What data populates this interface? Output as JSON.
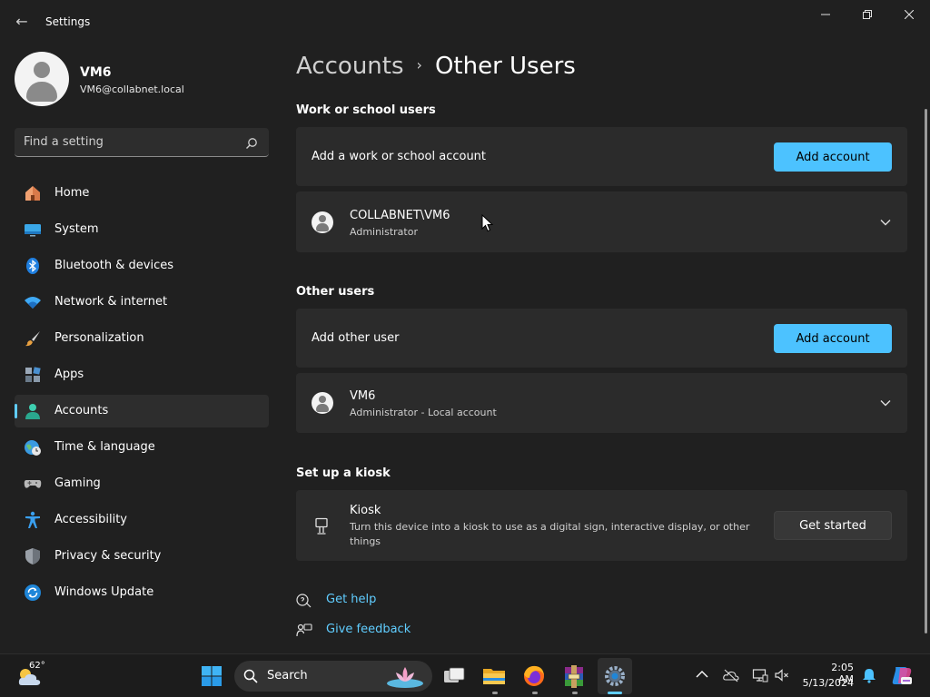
{
  "window": {
    "title": "Settings",
    "back_glyph": "←",
    "min_glyph": "—",
    "max_glyph": "❐",
    "close_glyph": "✕"
  },
  "profile": {
    "name": "VM6",
    "email": "VM6@collabnet.local"
  },
  "search": {
    "placeholder": "Find a setting"
  },
  "sidebar": {
    "items": [
      {
        "label": "Home",
        "icon": "home-icon"
      },
      {
        "label": "System",
        "icon": "system-icon"
      },
      {
        "label": "Bluetooth & devices",
        "icon": "bluetooth-icon"
      },
      {
        "label": "Network & internet",
        "icon": "wifi-icon"
      },
      {
        "label": "Personalization",
        "icon": "brush-icon"
      },
      {
        "label": "Apps",
        "icon": "apps-icon"
      },
      {
        "label": "Accounts",
        "icon": "accounts-icon",
        "active": true
      },
      {
        "label": "Time & language",
        "icon": "globe-clock-icon"
      },
      {
        "label": "Gaming",
        "icon": "gamepad-icon"
      },
      {
        "label": "Accessibility",
        "icon": "accessibility-icon"
      },
      {
        "label": "Privacy & security",
        "icon": "shield-icon"
      },
      {
        "label": "Windows Update",
        "icon": "update-icon"
      }
    ]
  },
  "breadcrumb": {
    "parent": "Accounts",
    "separator": "›",
    "current": "Other Users"
  },
  "work_school": {
    "section_title": "Work or school users",
    "add_text": "Add a work or school account",
    "add_button": "Add account",
    "user": {
      "name": "COLLABNET\\VM6",
      "role": "Administrator"
    }
  },
  "other_users": {
    "section_title": "Other users",
    "add_text": "Add other user",
    "add_button": "Add account",
    "user": {
      "name": "VM6",
      "role": "Administrator - Local account"
    }
  },
  "kiosk": {
    "section_title": "Set up a kiosk",
    "title": "Kiosk",
    "description_line1": "Turn this device into a kiosk to use as a digital sign, interactive display, or other",
    "description_line2": "things",
    "button": "Get started"
  },
  "links": {
    "help": "Get help",
    "feedback": "Give feedback"
  },
  "taskbar": {
    "weather_temp": "62°",
    "search_label": "Search",
    "time": "2:05 AM",
    "date": "5/13/2024",
    "pinned": [
      "start-icon",
      "task-view-icon",
      "file-explorer-icon",
      "firefox-icon",
      "winrar-icon",
      "settings-icon"
    ]
  },
  "colors": {
    "accent": "#4cc2ff",
    "link": "#60cdff",
    "background": "#202020",
    "card": "#2b2b2b"
  }
}
